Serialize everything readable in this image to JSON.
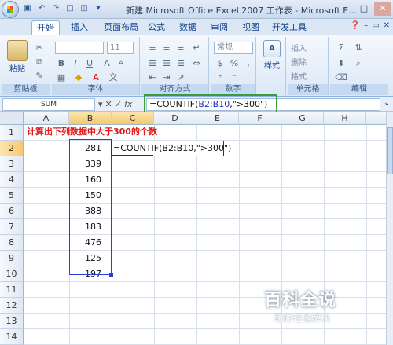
{
  "title": "新建 Microsoft Office Excel 2007 工作表 - Microsoft E...",
  "tabs": [
    "开始",
    "插入",
    "页面布局",
    "公式",
    "数据",
    "审阅",
    "视图",
    "开发工具"
  ],
  "ribbon": {
    "paste": "粘贴",
    "font_size": "11",
    "number_format": "常规",
    "styles": "样式",
    "insert": "插入",
    "delete": "删除",
    "format": "格式",
    "groups": [
      "剪贴板",
      "字体",
      "对齐方式",
      "数字",
      "单元格",
      "编辑"
    ]
  },
  "formula_bar": {
    "name_box": "SUM",
    "formula_prefix": "=COUNTIF(",
    "formula_ref": "B2:B10",
    "formula_suffix": ",\">300\")"
  },
  "columns": [
    "A",
    "B",
    "C",
    "D",
    "E",
    "F",
    "G",
    "H"
  ],
  "rows": [
    "1",
    "2",
    "3",
    "4",
    "5",
    "6",
    "7",
    "8",
    "9",
    "10",
    "11",
    "12",
    "13",
    "14"
  ],
  "sheet": {
    "A1": "计算出下列数据中大于300的个数",
    "B_values": [
      "281",
      "339",
      "160",
      "150",
      "388",
      "183",
      "476",
      "125",
      "197"
    ],
    "C2": "=COUNTIF(B2:B10,\">300\")"
  },
  "watermark": {
    "big": "百科全说",
    "small": "助你轻松解决"
  }
}
